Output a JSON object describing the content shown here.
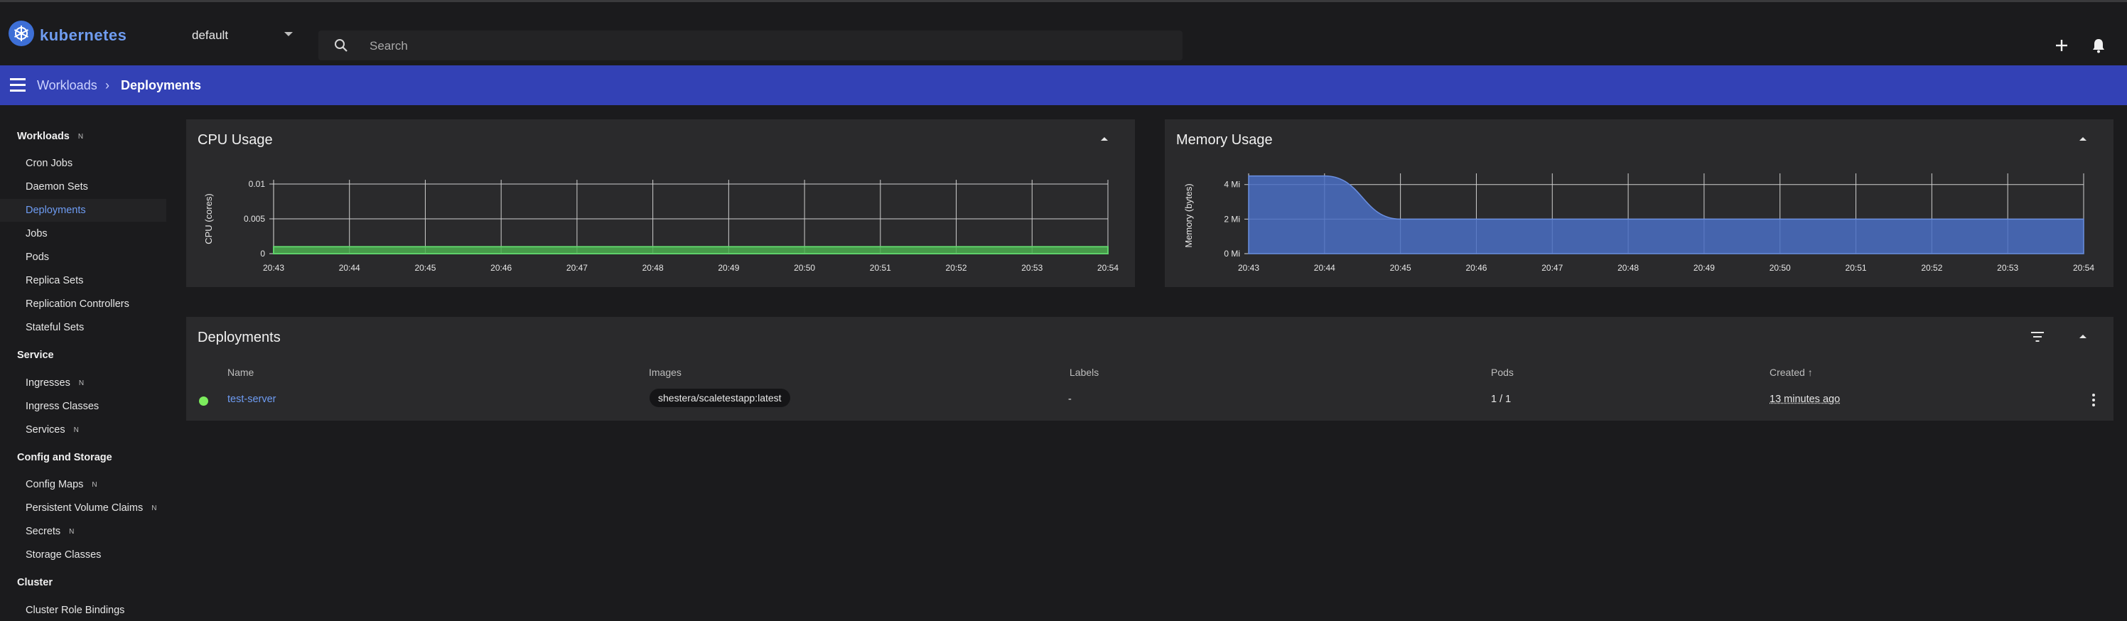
{
  "app": {
    "brand": "kubernetes"
  },
  "namespace": {
    "selected": "default"
  },
  "search": {
    "placeholder": "Search"
  },
  "toolbar": {
    "create_icon": "plus-icon",
    "notifications_icon": "bell-icon"
  },
  "breadcrumb": {
    "parent": "Workloads",
    "separator": "›",
    "current": "Deployments"
  },
  "sidebar": {
    "sections": [
      {
        "label": "Workloads",
        "badge": "N"
      },
      {
        "label": "Service"
      },
      {
        "label": "Config and Storage"
      },
      {
        "label": "Cluster"
      }
    ],
    "items": [
      {
        "label": "Cron Jobs"
      },
      {
        "label": "Daemon Sets"
      },
      {
        "label": "Deployments",
        "active": true
      },
      {
        "label": "Jobs"
      },
      {
        "label": "Pods"
      },
      {
        "label": "Replica Sets"
      },
      {
        "label": "Replication Controllers"
      },
      {
        "label": "Stateful Sets"
      },
      {
        "label": "Ingresses",
        "badge": "N"
      },
      {
        "label": "Ingress Classes"
      },
      {
        "label": "Services",
        "badge": "N"
      },
      {
        "label": "Config Maps",
        "badge": "N"
      },
      {
        "label": "Persistent Volume Claims",
        "badge": "N"
      },
      {
        "label": "Secrets",
        "badge": "N"
      },
      {
        "label": "Storage Classes"
      },
      {
        "label": "Cluster Role Bindings"
      }
    ]
  },
  "colors": {
    "accent_bar": "#3341b5",
    "cpu_fill": "#4caf50",
    "memory_fill": "#4a6fc4",
    "status_ok": "#7cec5d",
    "link": "#6e9cf3"
  },
  "chart_data": [
    {
      "type": "area",
      "title": "CPU Usage",
      "ylabel": "CPU (cores)",
      "x": [
        "20:43",
        "20:44",
        "20:45",
        "20:46",
        "20:47",
        "20:48",
        "20:49",
        "20:50",
        "20:51",
        "20:52",
        "20:53",
        "20:54"
      ],
      "y_ticks": [
        "0",
        "0.005",
        "0.01"
      ],
      "ylim": [
        0,
        0.01
      ],
      "series": [
        {
          "values": [
            0.001,
            0.001,
            0.001,
            0.001,
            0.001,
            0.001,
            0.001,
            0.001,
            0.001,
            0.001,
            0.001,
            0.001
          ]
        }
      ],
      "grid": true
    },
    {
      "type": "area",
      "title": "Memory Usage",
      "ylabel": "Memory (bytes)",
      "x": [
        "20:43",
        "20:44",
        "20:45",
        "20:46",
        "20:47",
        "20:48",
        "20:49",
        "20:50",
        "20:51",
        "20:52",
        "20:53",
        "20:54"
      ],
      "y_ticks": [
        "0 Mi",
        "2 Mi",
        "4 Mi"
      ],
      "ylim": [
        0,
        4.4
      ],
      "series": [
        {
          "values": [
            4.5,
            4.5,
            2.0,
            2.0,
            2.0,
            2.0,
            2.0,
            2.0,
            2.0,
            2.0,
            2.0,
            2.0
          ]
        }
      ],
      "grid": true
    }
  ],
  "deployments": {
    "title": "Deployments",
    "columns": [
      "Name",
      "Images",
      "Labels",
      "Pods",
      "Created"
    ],
    "sort_indicator": "↑",
    "rows": [
      {
        "name": "test-server",
        "image": "shestera/scaletestapp:latest",
        "labels": "-",
        "pods": "1 / 1",
        "created": "13 minutes ago",
        "status": "running"
      }
    ]
  }
}
